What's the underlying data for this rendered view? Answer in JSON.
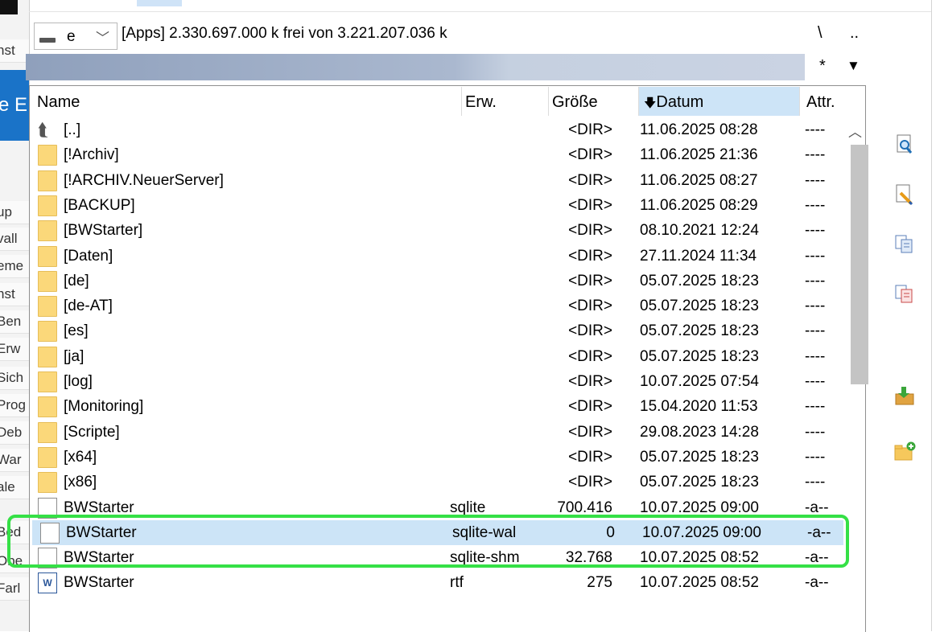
{
  "left_panel": {
    "blue_text": "e E",
    "items": [
      "nst",
      "up",
      "vall",
      "eme",
      "nst",
      "Ben",
      "Erw",
      "Sich",
      "Prog",
      "Deb",
      "War",
      "ale",
      "Bed",
      "Obe",
      "Farl"
    ]
  },
  "drive": {
    "letter": "e",
    "info": "[Apps]  2.330.697.000 k frei von 3.221.207.036 k",
    "root_btn": "\\",
    "up_btn": "..",
    "filter_star": "*",
    "filter_arrow": "▼"
  },
  "columns": {
    "name": "Name",
    "ext": "Erw.",
    "size": "Größe",
    "date": "Datum",
    "date_sort_arrow": "🡇",
    "attr": "Attr."
  },
  "rows": [
    {
      "icon": "up",
      "name": "[..]",
      "ext": "",
      "size": "<DIR>",
      "date": "11.06.2025 08:28",
      "attr": "----"
    },
    {
      "icon": "folder",
      "name": "[!Archiv]",
      "ext": "",
      "size": "<DIR>",
      "date": "11.06.2025 21:36",
      "attr": "----"
    },
    {
      "icon": "folder",
      "name": "[!ARCHIV.NeuerServer]",
      "ext": "",
      "size": "<DIR>",
      "date": "11.06.2025 08:27",
      "attr": "----"
    },
    {
      "icon": "folder",
      "name": "[BACKUP]",
      "ext": "",
      "size": "<DIR>",
      "date": "11.06.2025 08:29",
      "attr": "----"
    },
    {
      "icon": "folder",
      "name": "[BWStarter]",
      "ext": "",
      "size": "<DIR>",
      "date": "08.10.2021 12:24",
      "attr": "----"
    },
    {
      "icon": "folder",
      "name": "[Daten]",
      "ext": "",
      "size": "<DIR>",
      "date": "27.11.2024 11:34",
      "attr": "----"
    },
    {
      "icon": "folder",
      "name": "[de]",
      "ext": "",
      "size": "<DIR>",
      "date": "05.07.2025 18:23",
      "attr": "----"
    },
    {
      "icon": "folder",
      "name": "[de-AT]",
      "ext": "",
      "size": "<DIR>",
      "date": "05.07.2025 18:23",
      "attr": "----"
    },
    {
      "icon": "folder",
      "name": "[es]",
      "ext": "",
      "size": "<DIR>",
      "date": "05.07.2025 18:23",
      "attr": "----"
    },
    {
      "icon": "folder",
      "name": "[ja]",
      "ext": "",
      "size": "<DIR>",
      "date": "05.07.2025 18:23",
      "attr": "----"
    },
    {
      "icon": "folder",
      "name": "[log]",
      "ext": "",
      "size": "<DIR>",
      "date": "10.07.2025 07:54",
      "attr": "----"
    },
    {
      "icon": "folder",
      "name": "[Monitoring]",
      "ext": "",
      "size": "<DIR>",
      "date": "15.04.2020 11:53",
      "attr": "----"
    },
    {
      "icon": "folder",
      "name": "[Scripte]",
      "ext": "",
      "size": "<DIR>",
      "date": "29.08.2023 14:28",
      "attr": "----"
    },
    {
      "icon": "folder",
      "name": "[x64]",
      "ext": "",
      "size": "<DIR>",
      "date": "05.07.2025 18:23",
      "attr": "----"
    },
    {
      "icon": "folder",
      "name": "[x86]",
      "ext": "",
      "size": "<DIR>",
      "date": "05.07.2025 18:23",
      "attr": "----"
    },
    {
      "icon": "file",
      "name": "BWStarter",
      "ext": "sqlite",
      "size": "700.416",
      "date": "10.07.2025 09:00",
      "attr": "-a--"
    },
    {
      "icon": "file",
      "name": "BWStarter",
      "ext": "sqlite-wal",
      "size": "0",
      "date": "10.07.2025 09:00",
      "attr": "-a--"
    },
    {
      "icon": "file",
      "name": "BWStarter",
      "ext": "sqlite-shm",
      "size": "32.768",
      "date": "10.07.2025 08:52",
      "attr": "-a--"
    },
    {
      "icon": "word",
      "name": "BWStarter",
      "ext": "rtf",
      "size": "275",
      "date": "10.07.2025 08:52",
      "attr": "-a--"
    }
  ],
  "selected_row": 16,
  "highlight_color": "#35e046",
  "toolbar": [
    "search-icon",
    "edit-file-icon",
    "copy-files-icon",
    "move-files-icon",
    "pack-icon",
    "new-folder-icon"
  ]
}
